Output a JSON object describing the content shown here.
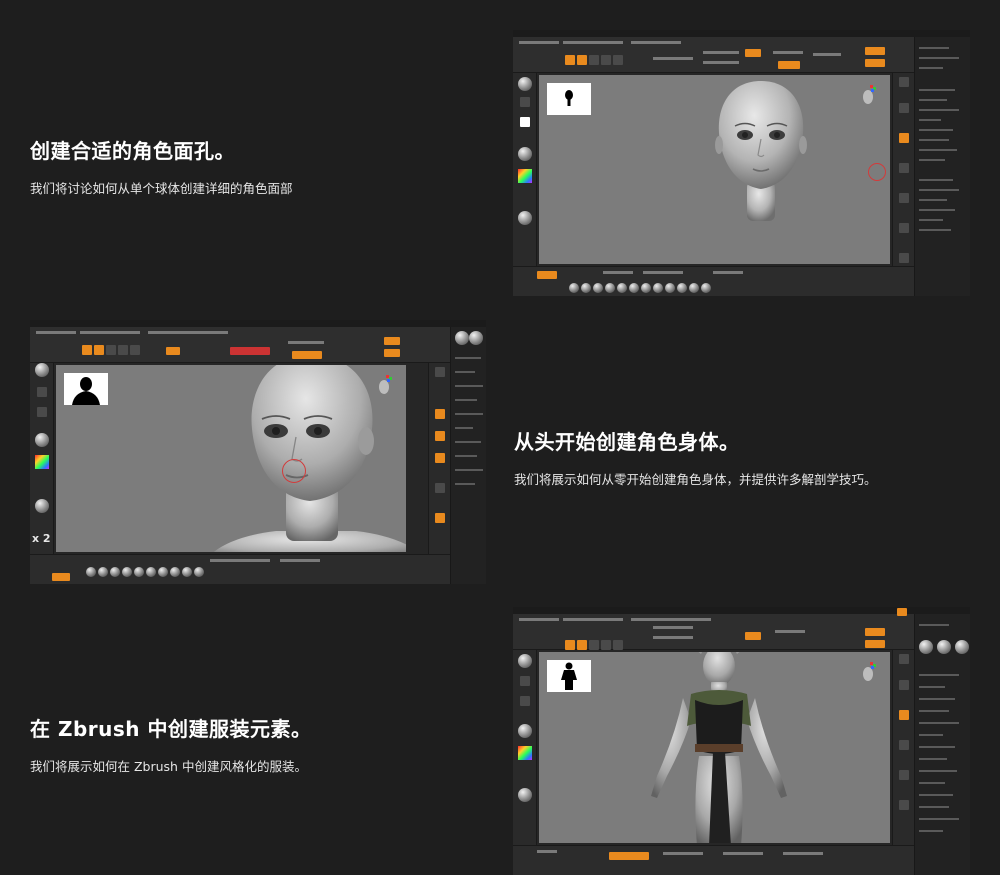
{
  "sections": [
    {
      "title": "创建合适的角色面孔。",
      "description": "我们将讨论如何从单个球体创建详细的角色面部"
    },
    {
      "title": "从头开始创建角色身体。",
      "description": "我们将展示如何从零开始创建角色身体，并提供许多解剖学技巧。"
    },
    {
      "title": "在 Zbrush 中创建服装元素。",
      "description": "我们将展示如何在 Zbrush 中创建风格化的服装。"
    }
  ],
  "screenshot_2": {
    "zoom_badge": "x 2"
  },
  "colors": {
    "background": "#1e1e1e",
    "accent": "#e98a1e",
    "canvas": "#7c7c7c"
  }
}
